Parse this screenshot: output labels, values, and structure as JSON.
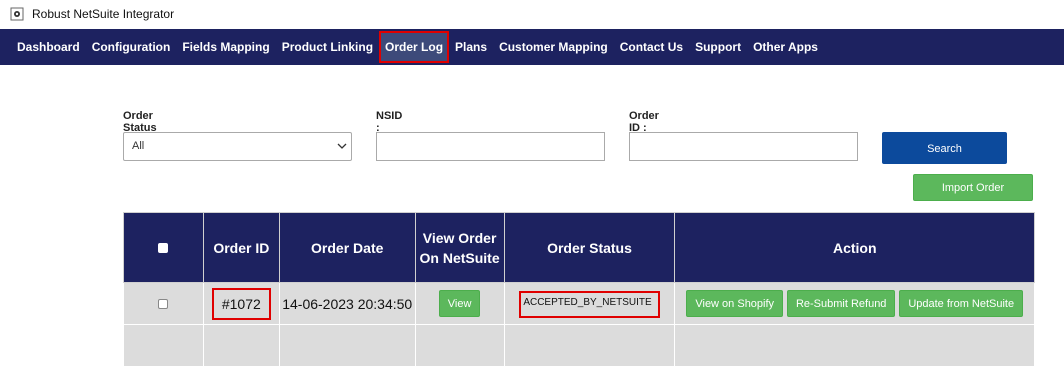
{
  "app": {
    "title": "Robust NetSuite Integrator",
    "icon": "gear-icon"
  },
  "nav": {
    "items": [
      {
        "label": "Dashboard"
      },
      {
        "label": "Configuration"
      },
      {
        "label": "Fields Mapping"
      },
      {
        "label": "Product Linking"
      },
      {
        "label": "Order Log",
        "active": true
      },
      {
        "label": "Plans"
      },
      {
        "label": "Customer Mapping"
      },
      {
        "label": "Contact Us"
      },
      {
        "label": "Support"
      },
      {
        "label": "Other Apps"
      }
    ]
  },
  "filters": {
    "order_status_label": "Order Status :",
    "order_status_value": "All",
    "nsid_label": "NSID :",
    "nsid_value": "",
    "order_id_label": "Order ID :",
    "order_id_value": "",
    "search_label": "Search",
    "import_label": "Import Order"
  },
  "table": {
    "headers": [
      "Order ID",
      "Order Date",
      "View Order On NetSuite",
      "Order Status",
      "Action"
    ],
    "rows": [
      {
        "order_id": "#1072",
        "order_date": "14-06-2023 20:34:50",
        "view_label": "View",
        "status": "ACCEPTED_BY_NETSUITE",
        "actions": [
          "View on Shopify",
          "Re-Submit Refund",
          "Update from NetSuite"
        ]
      }
    ]
  },
  "colors": {
    "nav_bg": "#1d2260",
    "primary_button": "#0c4a9c",
    "success_button": "#5cb85c",
    "highlight": "#e00000"
  }
}
